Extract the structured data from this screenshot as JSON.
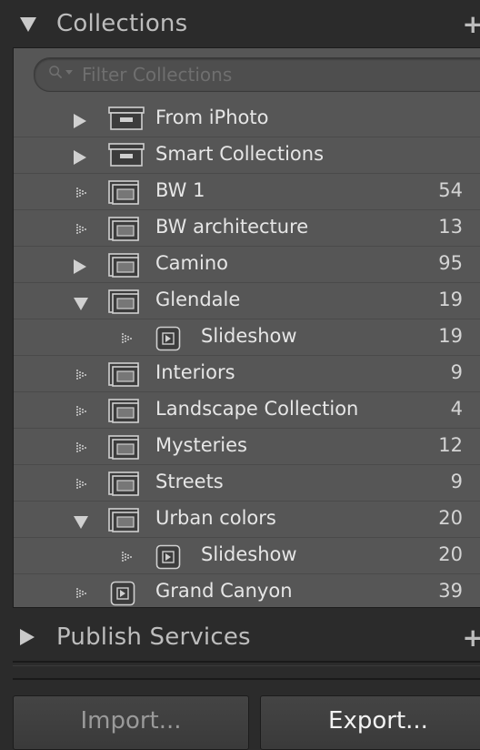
{
  "collections_panel": {
    "title": "Collections",
    "add_label": "+",
    "filter_placeholder": "Filter Collections",
    "rows": [
      {
        "name": "From iPhoto",
        "count": "",
        "icon": "collection-set-icon",
        "expander": "collapsed"
      },
      {
        "name": "Smart Collections",
        "count": "",
        "icon": "collection-set-icon",
        "expander": "collapsed"
      },
      {
        "name": "BW 1",
        "count": "54",
        "icon": "collection-icon",
        "expander": "none"
      },
      {
        "name": "BW architecture",
        "count": "13",
        "icon": "collection-icon",
        "expander": "none"
      },
      {
        "name": "Camino",
        "count": "95",
        "icon": "collection-icon",
        "expander": "collapsed"
      },
      {
        "name": "Glendale",
        "count": "19",
        "icon": "collection-icon",
        "expander": "expanded"
      },
      {
        "name": "Slideshow",
        "count": "19",
        "icon": "slideshow-icon",
        "expander": "none",
        "child": true
      },
      {
        "name": "Interiors",
        "count": "9",
        "icon": "collection-icon",
        "expander": "none"
      },
      {
        "name": "Landscape Collection",
        "count": "4",
        "icon": "collection-icon",
        "expander": "none"
      },
      {
        "name": "Mysteries",
        "count": "12",
        "icon": "collection-icon",
        "expander": "none"
      },
      {
        "name": "Streets",
        "count": "9",
        "icon": "collection-icon",
        "expander": "none"
      },
      {
        "name": "Urban colors",
        "count": "20",
        "icon": "collection-icon",
        "expander": "expanded"
      },
      {
        "name": "Slideshow",
        "count": "20",
        "icon": "slideshow-icon",
        "expander": "none",
        "child": true
      },
      {
        "name": "Grand Canyon",
        "count": "39",
        "icon": "slideshow-icon",
        "expander": "none"
      }
    ]
  },
  "publish_panel": {
    "title": "Publish Services",
    "add_label": "+"
  },
  "buttons": {
    "import_label": "Import...",
    "export_label": "Export..."
  }
}
